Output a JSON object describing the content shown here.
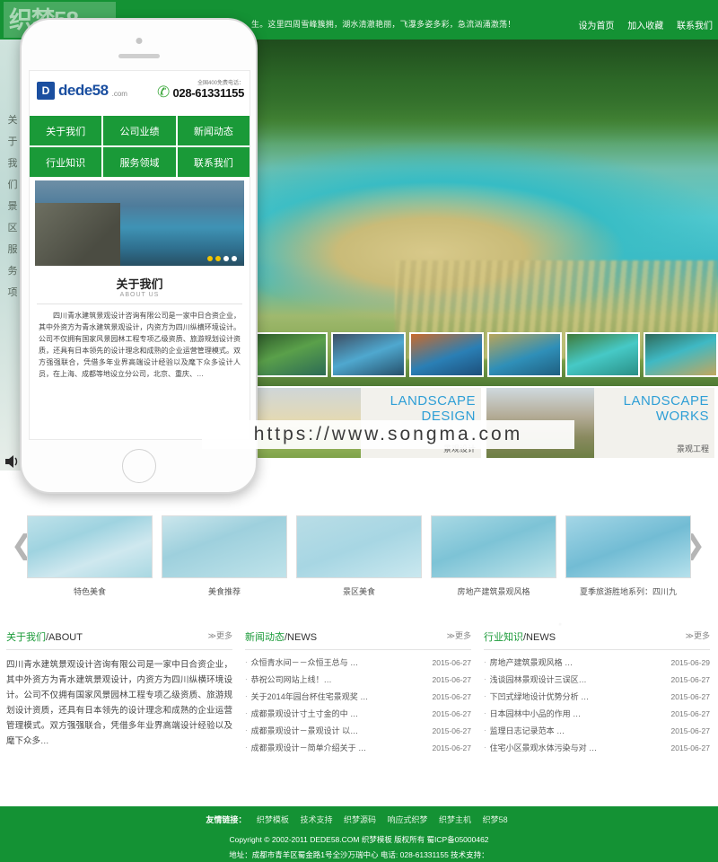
{
  "topbar": {
    "logo_text": "织梦58",
    "marquee": "生。这里四周雪峰簇拥，湖水清澈艳丽，飞瀑多姿多彩，急流汹涌激荡！",
    "links": [
      "设为首页",
      "加入收藏",
      "联系我们"
    ]
  },
  "left_strip": {
    "vertical_text": "关于我们景区服务项",
    "speaker_icon": "speaker-icon"
  },
  "watermark": {
    "text": "https://www.songma.com"
  },
  "phone": {
    "logo_mark": "D",
    "logo_text": "dede58",
    "logo_suffix": ".com",
    "phone_icon": "phone-icon",
    "tel_label": "全国400免费电话：",
    "tel_number": "028-61331155",
    "nav": [
      "关于我们",
      "公司业绩",
      "新闻动态",
      "行业知识",
      "服务领域",
      "联系我们"
    ],
    "about_cn": "关于我们",
    "about_en": "ABOUT US",
    "about_body": "四川青水建筑景观设计咨询有限公司是一家中日合资企业，其中外资方为青水建筑景观设计，内资方为四川纵横环境设计。公司不仅拥有国家风景园林工程专项乙级资质、旅游规划设计资质，还具有日本领先的设计理念和成熟的企业运营管理模式。双方强强联合，凭借多年业界高端设计经验以及麾下众多设计人员，在上海、成都等地设立分公司，北京、重庆、…"
  },
  "promos": [
    {
      "en_line1": "LANDSCAPE",
      "en_line2": "DESIGN",
      "cn": "景观设计",
      "image": "city-skyline-illustration"
    },
    {
      "en_line1": "LANDSCAPE",
      "en_line2": "WORKS",
      "cn": "景观工程",
      "image": "villa-garden-illustration"
    }
  ],
  "thumbnails": [
    "jiuzhaigou-thumb-1",
    "jiuzhaigou-thumb-2",
    "jiuzhaigou-thumb-3",
    "jiuzhaigou-thumb-4",
    "jiuzhaigou-thumb-5",
    "jiuzhaigou-thumb-6"
  ],
  "gallery": {
    "prev_icon": "chevron-left-icon",
    "next_icon": "chevron-right-icon",
    "items": [
      {
        "caption": "特色美食"
      },
      {
        "caption": "美食推荐"
      },
      {
        "caption": "景区美食"
      },
      {
        "caption": "房地产建筑景观风格"
      },
      {
        "caption": "夏季旅游胜地系列：四川九"
      }
    ]
  },
  "panels": {
    "about": {
      "title_cn": "关于我们",
      "title_en": "/ABOUT",
      "more": "≫更多",
      "body": "四川青水建筑景观设计咨询有限公司是一家中日合资企业，其中外资方为青水建筑景观设计，内资方为四川纵横环境设计。公司不仅拥有国家风景园林工程专项乙级资质、旅游规划设计资质，还具有日本领先的设计理念和成熟的企业运营管理模式。双方强强联合，凭借多年业界高端设计经验以及麾下众多…"
    },
    "news": {
      "title_cn": "新闻动态",
      "title_en": "/NEWS",
      "more": "≫更多",
      "items": [
        {
          "title": "众恒青水间－－众恒王总与 …",
          "date": "2015-06-27"
        },
        {
          "title": "恭祝公司网站上线！…",
          "date": "2015-06-27"
        },
        {
          "title": "关于2014年园台杯住宅景观奖 …",
          "date": "2015-06-27"
        },
        {
          "title": "成都景观设计寸土寸金的中 …",
          "date": "2015-06-27"
        },
        {
          "title": "成都景观设计－景观设计 以…",
          "date": "2015-06-27"
        },
        {
          "title": "成都景观设计－简单介绍关于 …",
          "date": "2015-06-27"
        }
      ]
    },
    "industry": {
      "title_cn": "行业知识",
      "title_en": "/NEWS",
      "more": "≫更多",
      "items": [
        {
          "title": "房地产建筑景观风格 …",
          "date": "2015-06-29"
        },
        {
          "title": "浅谈园林景观设计三误区…",
          "date": "2015-06-27"
        },
        {
          "title": "下凹式绿地设计优势分析 …",
          "date": "2015-06-27"
        },
        {
          "title": "日本园林中小品的作用 …",
          "date": "2015-06-27"
        },
        {
          "title": "监理日志记录范本 …",
          "date": "2015-06-27"
        },
        {
          "title": "住宅小区景观水体污染与对 …",
          "date": "2015-06-27"
        }
      ]
    }
  },
  "footer": {
    "friend_label": "友情链接：",
    "friend_links": [
      "织梦模板",
      "技术支持",
      "织梦源码",
      "响应式织梦",
      "织梦主机",
      "织梦58"
    ],
    "copyright": "Copyright © 2002-2011 DEDE58.COM 织梦模板 版权所有 蜀ICP备05000462",
    "address": "地址：成都市青羊区蜀金路1号全沙万瑞中心 电话: 028-61331155 技术支持："
  },
  "colors": {
    "brand_green": "#149234",
    "nav_green": "#1a9a38",
    "link_blue": "#2f9fd6",
    "logo_blue": "#1b4fa0"
  }
}
